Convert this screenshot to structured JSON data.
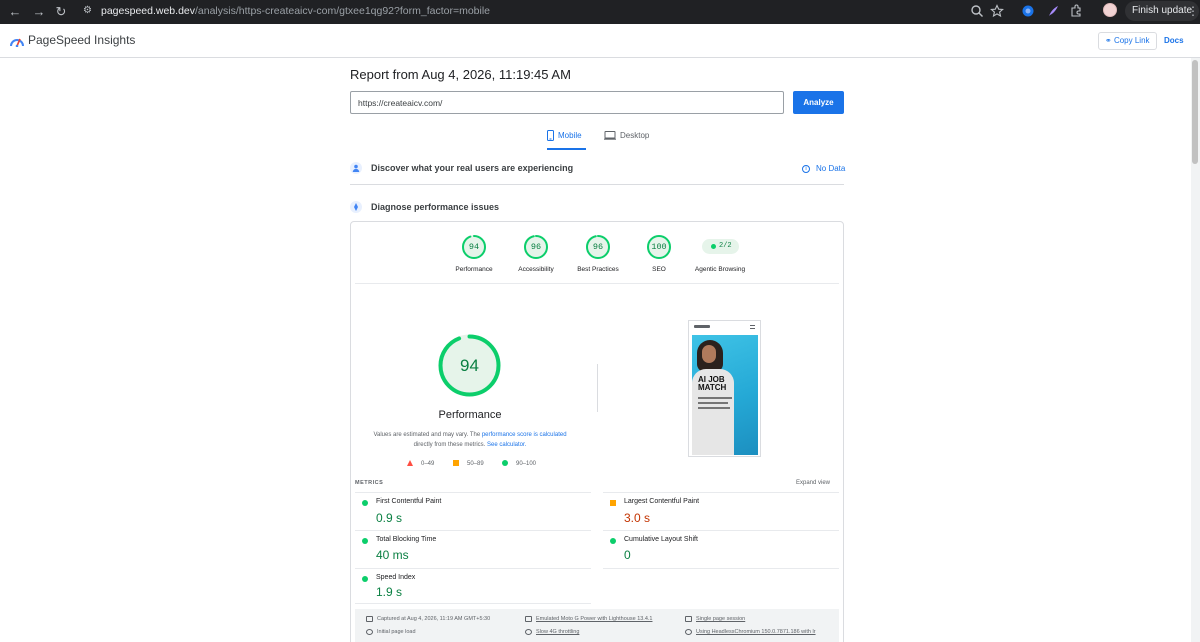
{
  "browser": {
    "url_host": "pagespeed.web.dev",
    "url_path": "/analysis/https-createaicv-com/gtxee1qg92?form_factor=mobile",
    "finish_update": "Finish update"
  },
  "header": {
    "app_title": "PageSpeed Insights",
    "copy_link": "Copy Link",
    "docs": "Docs"
  },
  "report": {
    "title": "Report from Aug 4, 2026, 11:19:45 AM",
    "url_value": "https://createaicv.com/",
    "analyze_label": "Analyze",
    "tabs": [
      {
        "label": "Mobile",
        "active": true
      },
      {
        "label": "Desktop",
        "active": false
      }
    ]
  },
  "sections": {
    "real_users": "Discover what your real users are experiencing",
    "no_data": "No Data",
    "diagnose": "Diagnose performance issues"
  },
  "scores": [
    {
      "label": "Performance",
      "value": "94"
    },
    {
      "label": "Accessibility",
      "value": "96"
    },
    {
      "label": "Best Practices",
      "value": "96"
    },
    {
      "label": "SEO",
      "value": "100"
    }
  ],
  "agentic": {
    "label": "Agentic Browsing",
    "value": "2/2"
  },
  "performance": {
    "score": "94",
    "title": "Performance",
    "note_a": "Values are estimated and may vary. The ",
    "note_link1": "performance score is calculated",
    "note_b": " directly from these metrics. ",
    "note_link2": "See calculator.",
    "legend": [
      "0–49",
      "50–89",
      "90–100"
    ]
  },
  "phone": {
    "headline_1": "AI JOB",
    "headline_2": "MATCH"
  },
  "metrics": {
    "heading": "METRICS",
    "expand": "Expand view",
    "items": [
      {
        "name": "First Contentful Paint",
        "value": "0.9 s",
        "rating": "good"
      },
      {
        "name": "Largest Contentful Paint",
        "value": "3.0 s",
        "rating": "average"
      },
      {
        "name": "Total Blocking Time",
        "value": "40 ms",
        "rating": "good"
      },
      {
        "name": "Cumulative Layout Shift",
        "value": "0",
        "rating": "good"
      },
      {
        "name": "Speed Index",
        "value": "1.9 s",
        "rating": "good"
      }
    ]
  },
  "info": {
    "captured": "Captured at Aug 4, 2026, 11:19 AM GMT+5:30",
    "initial_load": "Initial page load",
    "device": "Emulated Moto G Power with Lighthouse 13.4.1",
    "throttling": "Slow 4G throttling",
    "session": "Single page session",
    "browser": "Using HeadlessChromium 150.0.7871.186 with lr"
  },
  "colors": {
    "accent": "#1a73e8",
    "good": "#0cce6b",
    "average": "#ffa400",
    "poor": "#ff4e42"
  }
}
